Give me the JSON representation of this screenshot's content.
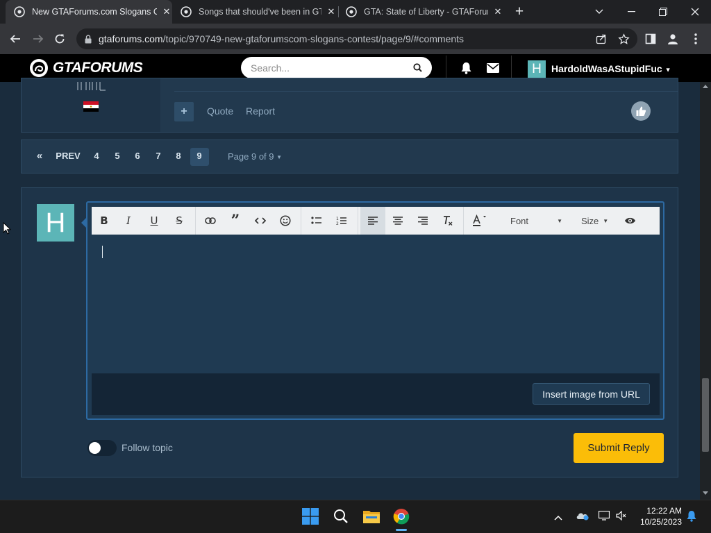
{
  "browser": {
    "tabs": [
      {
        "title": "New GTAForums.com Slogans Co",
        "active": true
      },
      {
        "title": "Songs that should've been in GTA",
        "active": false
      },
      {
        "title": "GTA: State of Liberty - GTAForum",
        "active": false
      }
    ],
    "url_domain": "gtaforums.com",
    "url_path": "/topic/970749-new-gtaforumscom-slogans-contest/page/9/#comments"
  },
  "site": {
    "logo_text": "GTAFORUMS",
    "search_placeholder": "Search...",
    "username": "HardoldWasAStupidFuc",
    "avatar_letter": "H"
  },
  "post": {
    "plus_label": "+",
    "quote_label": "Quote",
    "report_label": "Report"
  },
  "pagination": {
    "prev_icon": "«",
    "prev_label": "PREV",
    "pages": [
      "4",
      "5",
      "6",
      "7",
      "8",
      "9"
    ],
    "current": "9",
    "page_of": "Page 9 of 9"
  },
  "reply": {
    "avatar_letter": "H",
    "toolbar": {
      "font_label": "Font",
      "size_label": "Size"
    },
    "insert_image_label": "Insert image from URL",
    "follow_label": "Follow topic",
    "submit_label": "Submit Reply"
  },
  "taskbar": {
    "time": "12:22 AM",
    "date": "10/25/2023"
  },
  "colors": {
    "accent_yellow": "#fbbd08",
    "panel_bg": "#1e3449",
    "avatar_teal": "#5cb5b7"
  }
}
